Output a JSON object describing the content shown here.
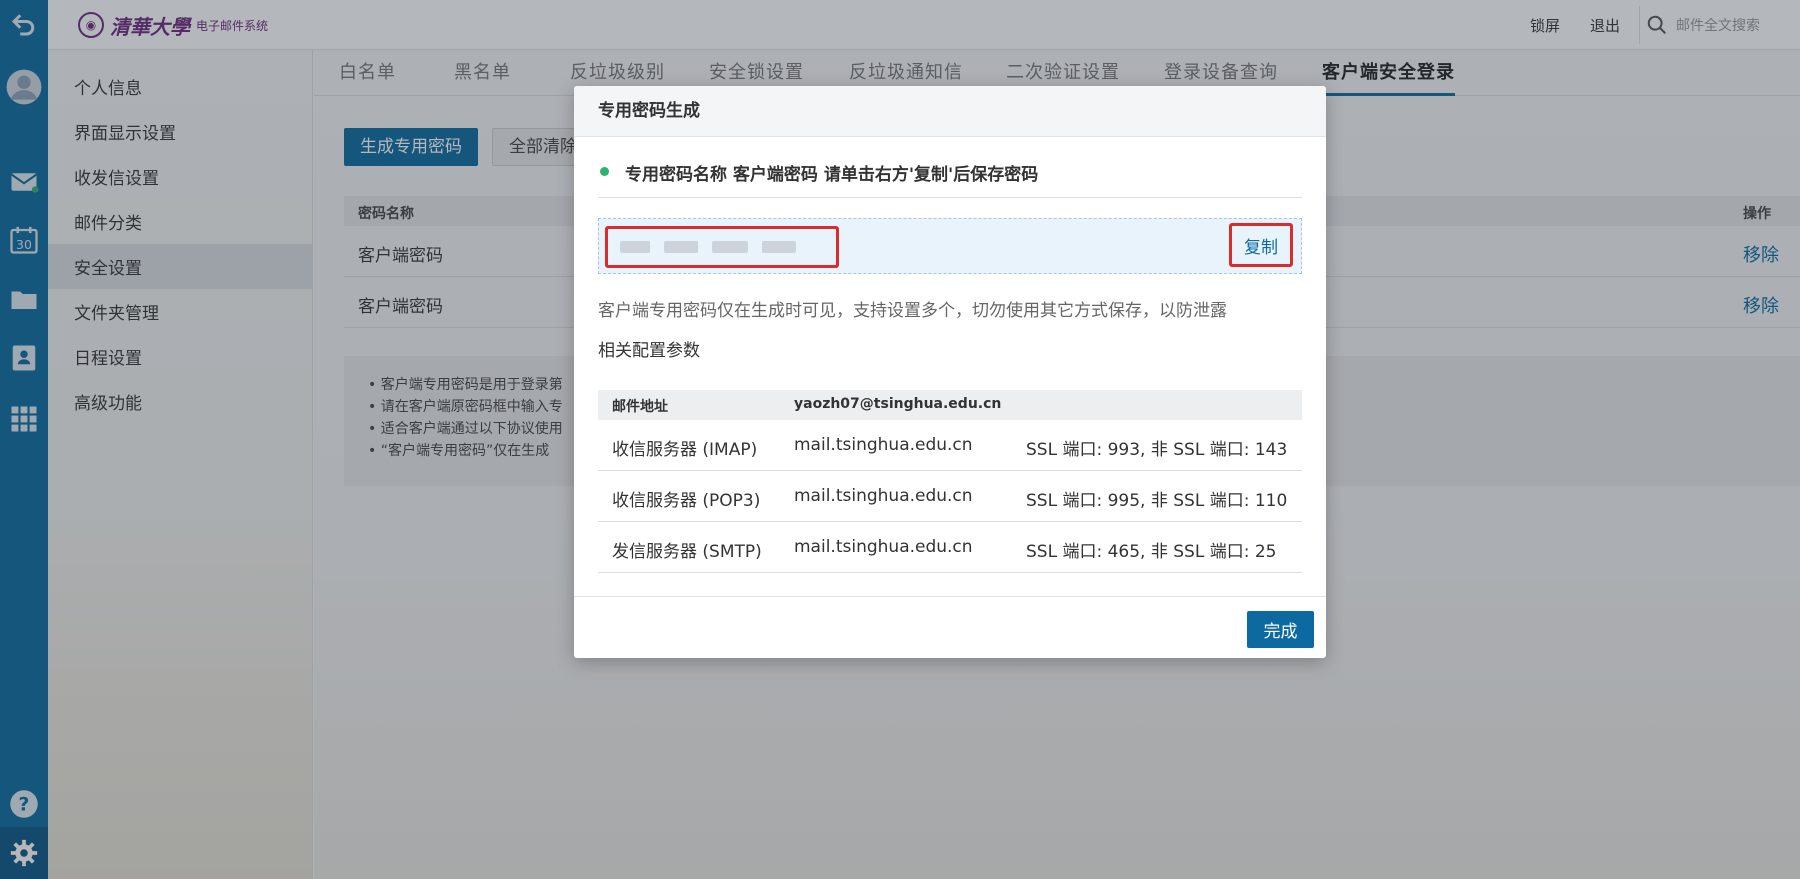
{
  "topbar": {
    "logo_name": "清華大學",
    "logo_sys": "电子邮件系统",
    "lock_label": "锁屏",
    "logout_label": "退出",
    "search_placeholder": "邮件全文搜索"
  },
  "rail": {
    "icons": [
      "back-arrow-icon",
      "avatar-icon",
      "mail-icon",
      "calendar-icon",
      "folder-icon",
      "contacts-icon",
      "apps-grid-icon",
      "help-icon",
      "gear-icon"
    ],
    "calendar_day": "30"
  },
  "sidebar": {
    "items": [
      {
        "label": "个人信息"
      },
      {
        "label": "界面显示设置"
      },
      {
        "label": "收发信设置"
      },
      {
        "label": "邮件分类"
      },
      {
        "label": "安全设置"
      },
      {
        "label": "文件夹管理"
      },
      {
        "label": "日程设置"
      },
      {
        "label": "高级功能"
      }
    ],
    "active_index": 4
  },
  "tabs": [
    {
      "label": "白名单"
    },
    {
      "label": "黑名单"
    },
    {
      "label": "反垃圾级别"
    },
    {
      "label": "安全锁设置"
    },
    {
      "label": "反垃圾通知信"
    },
    {
      "label": "二次验证设置"
    },
    {
      "label": "登录设备查询"
    },
    {
      "label": "客户端安全登录"
    }
  ],
  "toolbar": {
    "generate_label": "生成专用密码",
    "clear_label": "全部清除"
  },
  "table": {
    "col_name": "密码名称",
    "col_action": "操作",
    "rows": [
      {
        "name": "客户端密码",
        "action": "移除"
      },
      {
        "name": "客户端密码",
        "action": "移除"
      }
    ]
  },
  "tips": [
    "• 客户端专用密码是用于登录第",
    "• 请在客户端原密码框中输入专",
    "• 适合客户端通过以下协议使用",
    "• “客户端专用密码”仅在生成"
  ],
  "dialog": {
    "title": "专用密码生成",
    "notice": "专用密码名称 客户端密码 请单击右方'复制'后保存密码",
    "copy_label": "复制",
    "hint": "客户端专用密码仅在生成时可见，支持设置多个，切勿使用其它方式保存，以防泄露",
    "config_title": "相关配置参数",
    "config": {
      "head_label": "邮件地址",
      "head_value": "yaozh07@tsinghua.edu.cn",
      "rows": [
        {
          "label": "收信服务器 (IMAP)",
          "host": "mail.tsinghua.edu.cn",
          "ports": "SSL 端口: 993, 非 SSL 端口: 143"
        },
        {
          "label": "收信服务器 (POP3)",
          "host": "mail.tsinghua.edu.cn",
          "ports": "SSL 端口: 995, 非 SSL 端口: 110"
        },
        {
          "label": "发信服务器 (SMTP)",
          "host": "mail.tsinghua.edu.cn",
          "ports": "SSL 端口: 465, 非 SSL 端口: 25"
        }
      ]
    },
    "done_label": "完成"
  },
  "colors": {
    "brand_blue": "#0c6aa0",
    "highlight_red": "#d92c2c",
    "status_green": "#2bb36b",
    "logo_purple": "#6d2b7d"
  }
}
